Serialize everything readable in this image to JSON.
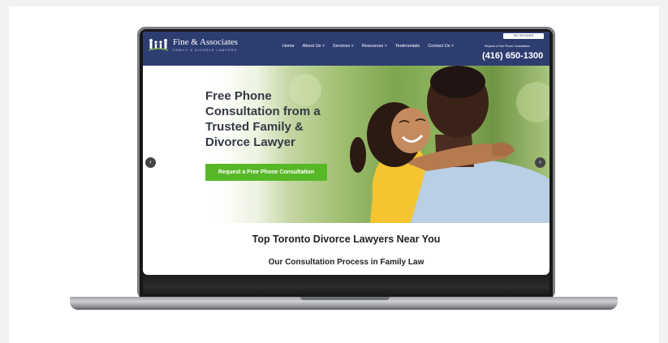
{
  "site": {
    "logo": {
      "title": "Fine & Associates",
      "subtitle": "FAMILY & DIVORCE LAWYERS",
      "icon": "family-figures-icon"
    },
    "nav": [
      "Home",
      "About Us ˅",
      "Services ˅",
      "Resources ˅",
      "Testimonials",
      "Contact Us ˅"
    ],
    "pay_button": "PAY RETAINER",
    "request_text": "Request a Free Phone Consultation",
    "phone": "(416) 650-1300"
  },
  "hero": {
    "heading": "Free Phone Consultation from a Trusted Family & Divorce Lawyer",
    "cta": "Request a Free Phone Consultation",
    "prev_icon": "chevron-left-icon",
    "next_icon": "chevron-right-icon"
  },
  "sections": {
    "top_lawyers": "Top Toronto Divorce Lawyers Near You",
    "process": "Our Consultation Process in Family Law"
  },
  "colors": {
    "header_bg": "#2e3d70",
    "cta_green": "#57b827",
    "text_dark": "#333a44"
  }
}
